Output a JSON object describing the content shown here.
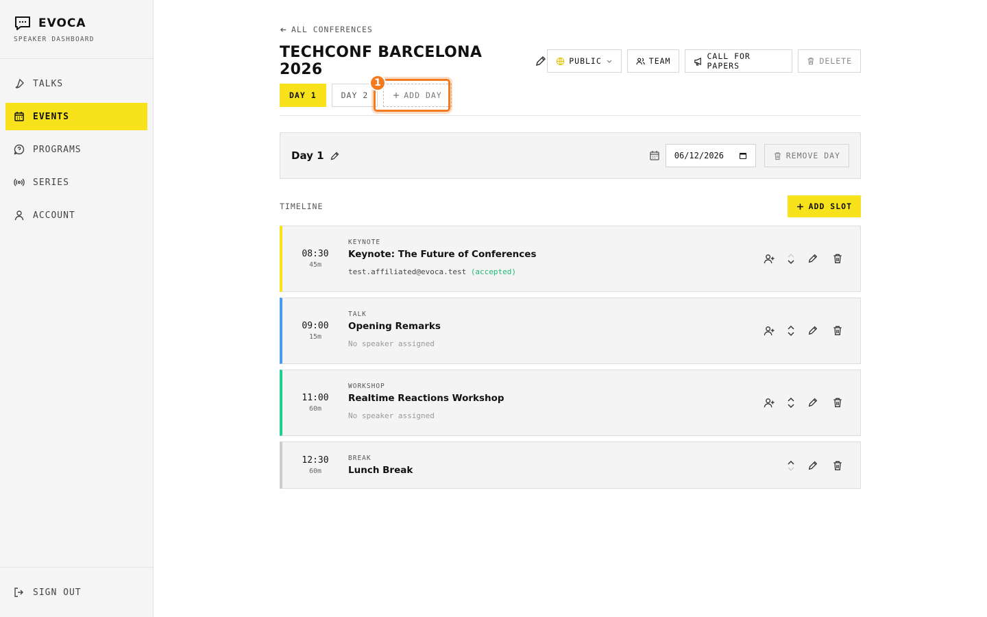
{
  "sidebar": {
    "brand": "EVOCA",
    "subtitle": "SPEAKER DASHBOARD",
    "items": [
      {
        "label": "TALKS",
        "icon": "mic-icon"
      },
      {
        "label": "EVENTS",
        "icon": "calendar-icon",
        "active": true
      },
      {
        "label": "PROGRAMS",
        "icon": "help-circle-icon"
      },
      {
        "label": "SERIES",
        "icon": "broadcast-icon"
      },
      {
        "label": "ACCOUNT",
        "icon": "user-icon"
      }
    ],
    "signout": "SIGN OUT"
  },
  "header": {
    "back": "ALL CONFERENCES",
    "title": "TECHCONF BARCELONA 2026",
    "actions": {
      "visibility": "PUBLIC",
      "team": "TEAM",
      "cfp": "CALL FOR PAPERS",
      "delete": "DELETE"
    }
  },
  "tabs": {
    "day1": "DAY 1",
    "day2": "DAY 2",
    "add": "ADD DAY",
    "step_badge": "1"
  },
  "day": {
    "name": "Day 1",
    "date": "06/12/2026",
    "remove": "REMOVE DAY"
  },
  "timeline": {
    "label": "TIMELINE",
    "add_slot": "ADD SLOT",
    "slots": [
      {
        "time": "08:30",
        "duration": "45m",
        "kind": "KEYNOTE",
        "title": "Keynote: The Future of Conferences",
        "speaker": "test.affiliated@evoca.test",
        "status": "(accepted)",
        "color": "#f7e21b"
      },
      {
        "time": "09:00",
        "duration": "15m",
        "kind": "TALK",
        "title": "Opening Remarks",
        "speaker": "No speaker assigned",
        "color": "#4c9aef"
      },
      {
        "time": "11:00",
        "duration": "60m",
        "kind": "WORKSHOP",
        "title": "Realtime Reactions Workshop",
        "speaker": "No speaker assigned",
        "color": "#1fcf8a"
      },
      {
        "time": "12:30",
        "duration": "60m",
        "kind": "BREAK",
        "title": "Lunch Break",
        "color": "#cccccc"
      }
    ]
  },
  "colors": {
    "accent": "#f7e21b",
    "highlight": "#f47a1f",
    "accepted": "#1fb87a"
  }
}
